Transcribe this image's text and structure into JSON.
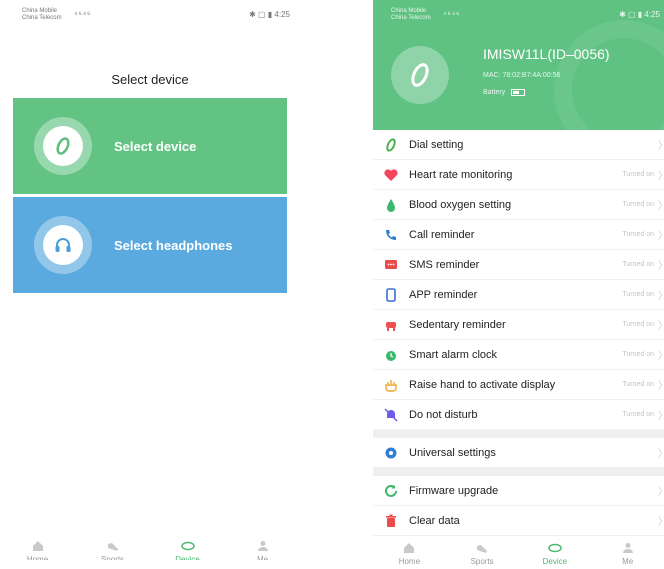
{
  "left_screen": {
    "status": {
      "carrier_line1": "China Mobile",
      "carrier_line2": "China Telecom",
      "signal": "⁴⁶⁴⁶",
      "right": "4:25"
    },
    "title": "Select device",
    "cards": [
      {
        "label": "Select device",
        "icon": "watch-icon",
        "color": "#62c383"
      },
      {
        "label": "Select headphones",
        "icon": "headphones-icon",
        "color": "#5aaadf"
      }
    ],
    "tabs": [
      {
        "label": "Home",
        "icon": "home-icon"
      },
      {
        "label": "Sports",
        "icon": "shoe-icon"
      },
      {
        "label": "Device",
        "icon": "band-icon"
      },
      {
        "label": "Me",
        "icon": "user-icon"
      }
    ]
  },
  "right_screen": {
    "status": {
      "carrier_line1": "China Mobile",
      "carrier_line2": "China Telecom",
      "right": "4:25"
    },
    "device": {
      "name": "IMISW11L(ID–0056)",
      "mac": "MAC: 78:02:B7:4A:00:56",
      "battery_label": "Battery"
    },
    "menu": [
      {
        "label": "Dial setting",
        "status": "",
        "icon": "dial-icon",
        "color": "#4caf50"
      },
      {
        "label": "Heart rate monitoring",
        "status": "Turned on",
        "icon": "heart-icon",
        "color": "#f4465a"
      },
      {
        "label": "Blood oxygen setting",
        "status": "Turned on",
        "icon": "drop-icon",
        "color": "#3bb86b"
      },
      {
        "label": "Call reminder",
        "status": "Turned on",
        "icon": "phone-icon",
        "color": "#2f7fd4"
      },
      {
        "label": "SMS reminder",
        "status": "Turned on",
        "icon": "sms-icon",
        "color": "#e94b4b"
      },
      {
        "label": "APP reminder",
        "status": "Turned on",
        "icon": "app-icon",
        "color": "#3b6fd1"
      },
      {
        "label": "Sedentary reminder",
        "status": "Turned on",
        "icon": "seat-icon",
        "color": "#ec5050"
      },
      {
        "label": "Smart alarm clock",
        "status": "Turned on",
        "icon": "alarm-icon",
        "color": "#3bb86b"
      },
      {
        "label": "Raise hand to activate display",
        "status": "Turned on",
        "icon": "hand-icon",
        "color": "#f2a62a"
      },
      {
        "label": "Do not disturb",
        "status": "Turned on",
        "icon": "mute-icon",
        "color": "#6c5ce7"
      }
    ],
    "menu2": [
      {
        "label": "Universal settings",
        "status": "",
        "icon": "gear-icon",
        "color": "#2f7fd4"
      }
    ],
    "menu3": [
      {
        "label": "Firmware upgrade",
        "status": "",
        "icon": "refresh-icon",
        "color": "#3bb86b"
      },
      {
        "label": "Clear data",
        "status": "",
        "icon": "trash-icon",
        "color": "#e94b4b"
      }
    ],
    "tabs": [
      {
        "label": "Home",
        "icon": "home-icon"
      },
      {
        "label": "Sports",
        "icon": "shoe-icon"
      },
      {
        "label": "Device",
        "icon": "band-icon"
      },
      {
        "label": "Me",
        "icon": "user-icon"
      }
    ]
  }
}
